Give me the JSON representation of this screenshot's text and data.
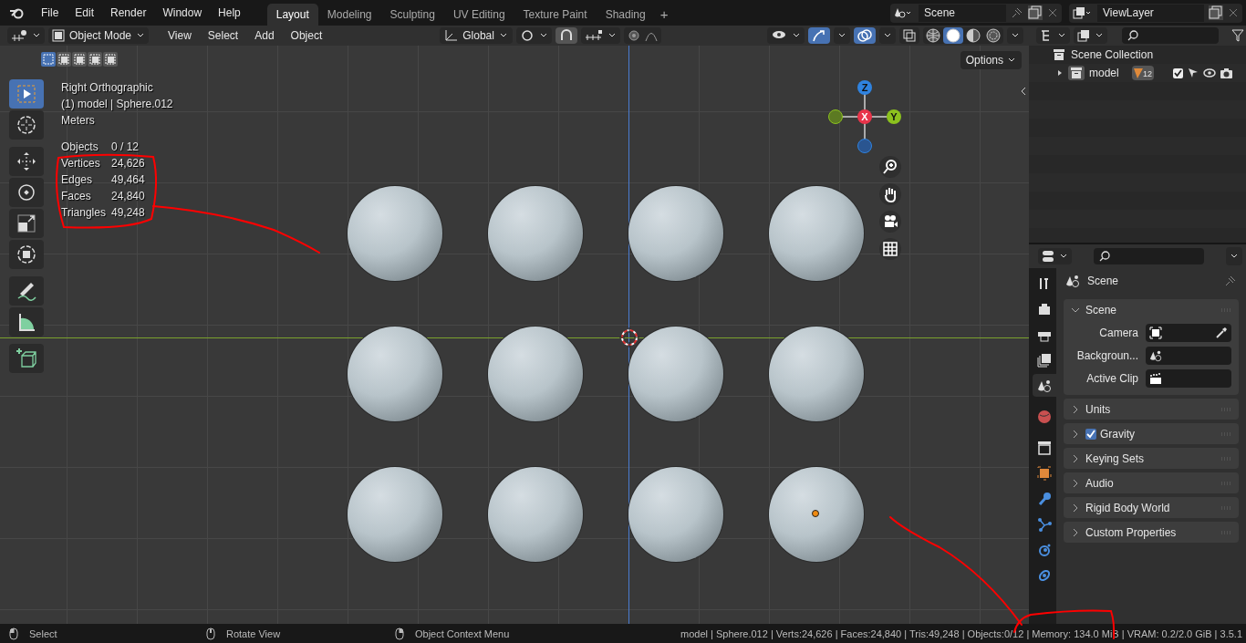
{
  "top_menu": [
    "File",
    "Edit",
    "Render",
    "Window",
    "Help"
  ],
  "workspaces": [
    {
      "label": "Layout",
      "selected": true
    },
    {
      "label": "Modeling",
      "selected": false
    },
    {
      "label": "Sculpting",
      "selected": false
    },
    {
      "label": "UV Editing",
      "selected": false
    },
    {
      "label": "Texture Paint",
      "selected": false
    },
    {
      "label": "Shading",
      "selected": false
    }
  ],
  "add_workspace": "+",
  "scene_field": "Scene",
  "view_layer_field": "ViewLayer",
  "viewport_header": {
    "mode": "Object Mode",
    "menus": [
      "View",
      "Select",
      "Add",
      "Object"
    ],
    "orientation": "Global",
    "snap": {
      "on": true
    },
    "proportional_editing": {
      "on": false
    },
    "gizmos": {
      "on": true
    },
    "overlays": {
      "on": true
    },
    "xray": {
      "on": false
    },
    "shading_modes": [
      {
        "kind": "wireframe",
        "selected": false
      },
      {
        "kind": "solid",
        "selected": true
      },
      {
        "kind": "material",
        "selected": false
      },
      {
        "kind": "rendered",
        "selected": false
      }
    ]
  },
  "select_modes": [
    {
      "selected": true
    },
    {
      "selected": false
    },
    {
      "selected": false
    },
    {
      "selected": false
    },
    {
      "selected": false
    }
  ],
  "options_button": "Options",
  "tools": [
    {
      "kind": "select",
      "selected": true
    },
    {
      "kind": "cursor",
      "selected": false
    },
    {
      "kind": "move",
      "selected": false
    },
    {
      "kind": "rotate",
      "selected": false
    },
    {
      "kind": "scale",
      "selected": false
    },
    {
      "kind": "transform",
      "selected": false
    },
    {
      "kind": "annotate",
      "selected": false
    },
    {
      "kind": "measure",
      "selected": false
    },
    {
      "kind": "add-cube",
      "selected": false
    }
  ],
  "overlay_info": {
    "view": "Right Orthographic",
    "object": "(1) model | Sphere.012",
    "units": "Meters",
    "stats": [
      {
        "label": "Objects",
        "value": "0 / 12"
      },
      {
        "label": "Vertices",
        "value": "24,626"
      },
      {
        "label": "Edges",
        "value": "49,464"
      },
      {
        "label": "Faces",
        "value": "24,840"
      },
      {
        "label": "Triangles",
        "value": "49,248"
      }
    ]
  },
  "gizmo_axes": {
    "z": "Z",
    "x": "X",
    "y": "Y"
  },
  "spheres": [
    {
      "active": false
    },
    {
      "active": false
    },
    {
      "active": false
    },
    {
      "active": false
    },
    {
      "active": false
    },
    {
      "active": false
    },
    {
      "active": false
    },
    {
      "active": false
    },
    {
      "active": false
    },
    {
      "active": false
    },
    {
      "active": false
    },
    {
      "active": true
    }
  ],
  "outliner": {
    "root": "Scene Collection",
    "children": [
      {
        "name": "model",
        "expanded": false,
        "count": "12",
        "checked": true
      }
    ]
  },
  "properties": {
    "context": "Scene",
    "tabs": [
      {
        "kind": "tool",
        "selected": false
      },
      {
        "kind": "render",
        "selected": false
      },
      {
        "kind": "output",
        "selected": false
      },
      {
        "kind": "view-layer",
        "selected": false
      },
      {
        "kind": "scene",
        "selected": true
      },
      {
        "kind": "world",
        "selected": false
      },
      {
        "kind": "collection",
        "selected": false
      },
      {
        "kind": "object",
        "selected": false
      },
      {
        "kind": "modifier",
        "selected": false
      },
      {
        "kind": "particles",
        "selected": false
      },
      {
        "kind": "physics",
        "selected": false
      },
      {
        "kind": "constraints",
        "selected": false
      }
    ],
    "panels": [
      {
        "title": "Scene",
        "expanded": true,
        "fields": [
          {
            "label": "Camera",
            "kind": "camera"
          },
          {
            "label": "Backgroun...",
            "kind": "scene"
          },
          {
            "label": "Active Clip",
            "kind": "clip"
          }
        ]
      },
      {
        "title": "Units",
        "expanded": false
      },
      {
        "title": "Gravity",
        "expanded": false,
        "checked": true
      },
      {
        "title": "Keying Sets",
        "expanded": false
      },
      {
        "title": "Audio",
        "expanded": false
      },
      {
        "title": "Rigid Body World",
        "expanded": false
      },
      {
        "title": "Custom Properties",
        "expanded": false
      }
    ]
  },
  "status_bar": {
    "hints": [
      "Select",
      "Rotate View",
      "Object Context Menu"
    ],
    "info": "model | Sphere.012 | Verts:24,626 | Faces:24,840 | Tris:49,248 | Objects:0/12 | Memory: 134.0 MiB | VRAM: 0.2/2.0 GiB | 3.5.1"
  }
}
